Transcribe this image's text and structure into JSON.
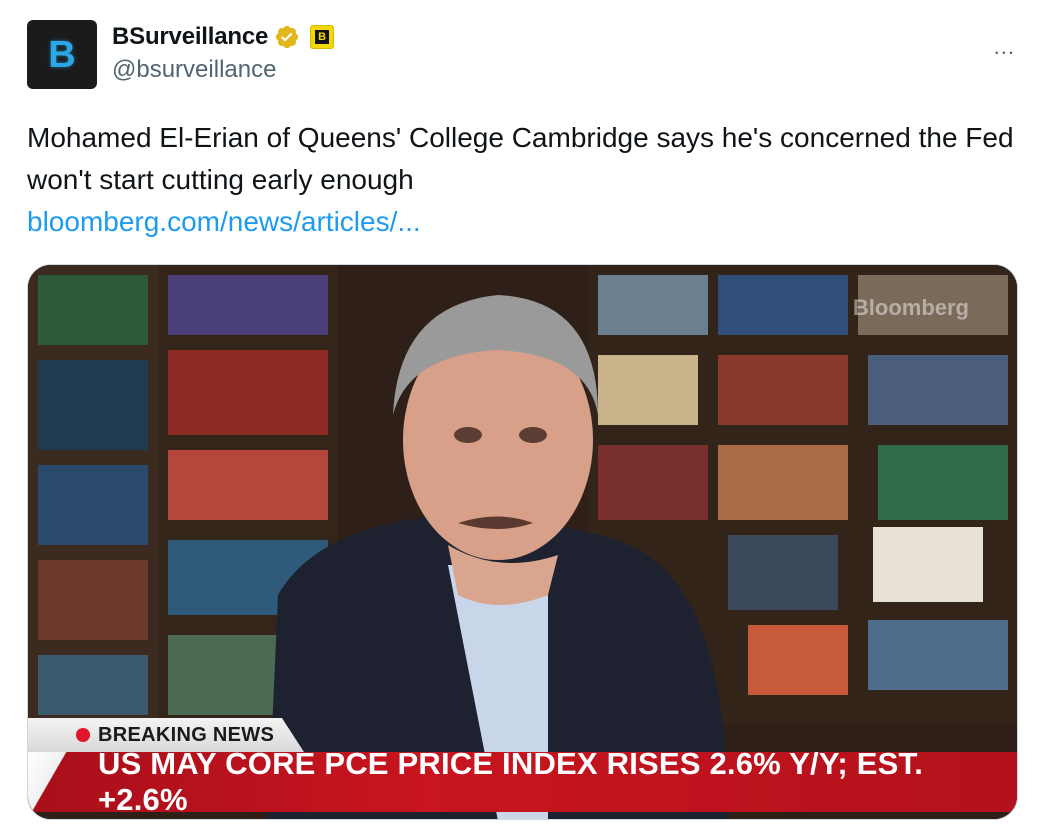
{
  "author": {
    "display_name": "BSurveillance",
    "handle": "@bsurveillance",
    "avatar_letter": "B",
    "affiliate_letter": "B",
    "verified_badge": "gold-check-icon"
  },
  "tweet": {
    "text": "Mohamed El-Erian of Queens' College Cambridge says he's concerned the Fed won't start cutting early enough",
    "link": "bloomberg.com/news/articles/..."
  },
  "menu": {
    "more_label": "..."
  },
  "media": {
    "watermark": "Bloomberg",
    "breaking_label": "BREAKING NEWS",
    "headline": "US MAY CORE PCE PRICE INDEX RISES 2.6% Y/Y; EST. +2.6%"
  },
  "colors": {
    "link": "#1d9bf0",
    "secondary_text": "#536471",
    "headline_red": "#c8151f",
    "affiliate_yellow": "#f2d700",
    "verified_gold": "#e2b719"
  }
}
